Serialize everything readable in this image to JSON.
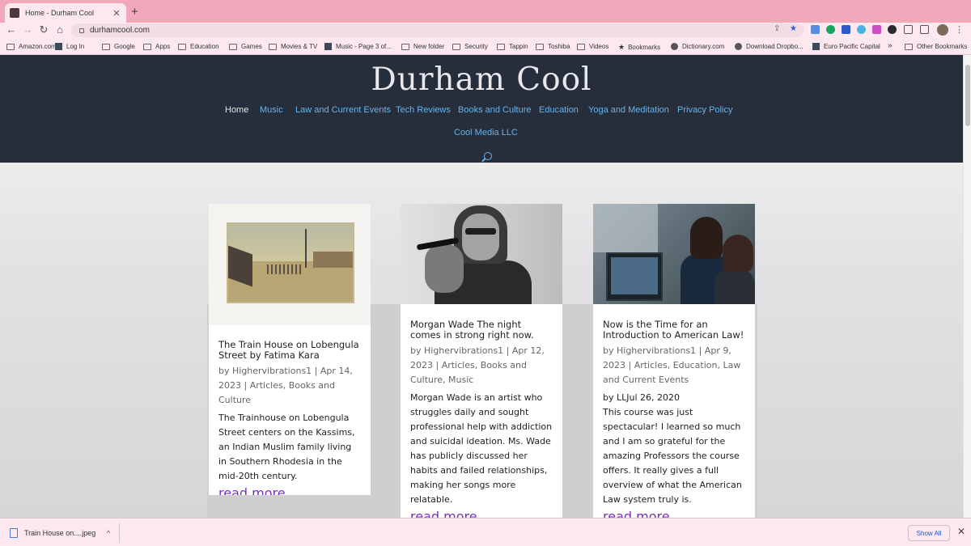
{
  "browser": {
    "tab_title": "Home - Durham Cool",
    "tab_close": "✕",
    "new_tab": "+",
    "url": "durhamcool.com",
    "bookmarks": [
      {
        "label": "Amazon.com",
        "icon": "folder"
      },
      {
        "label": "Log In",
        "icon": "square"
      },
      {
        "label": "Google",
        "icon": "folder"
      },
      {
        "label": "Apps",
        "icon": "folder"
      },
      {
        "label": "Education",
        "icon": "folder"
      },
      {
        "label": "Games",
        "icon": "folder"
      },
      {
        "label": "Movies & TV",
        "icon": "folder"
      },
      {
        "label": "Music - Page 3 of...",
        "icon": "square"
      },
      {
        "label": "New folder",
        "icon": "folder"
      },
      {
        "label": "Security",
        "icon": "folder"
      },
      {
        "label": "Tappin",
        "icon": "folder"
      },
      {
        "label": "Toshiba",
        "icon": "folder"
      },
      {
        "label": "Videos",
        "icon": "folder"
      },
      {
        "label": "Bookmarks",
        "icon": "star"
      },
      {
        "label": "Dictionary.com",
        "icon": "globe"
      },
      {
        "label": "Download Dropbo...",
        "icon": "globe"
      },
      {
        "label": "Euro Pacific Capital",
        "icon": "square"
      }
    ],
    "more_bookmarks": "»",
    "other_bookmarks": "Other Bookmarks"
  },
  "site": {
    "title": "Durham Cool",
    "menu": [
      {
        "label": "Home",
        "active": true
      },
      {
        "label": "Music"
      },
      {
        "label": "Law and Current Events"
      },
      {
        "label": "Tech Reviews"
      },
      {
        "label": "Books and Culture"
      },
      {
        "label": "Education"
      },
      {
        "label": "Yoga and Meditation"
      },
      {
        "label": "Privacy Policy"
      },
      {
        "label": "Cool Media LLC"
      }
    ],
    "accent_link_color": "#69b4ea",
    "header_bg": "#262d3b",
    "read_more_color": "#7b2fb5"
  },
  "posts": [
    {
      "title": "The Train House on Lobengula Street by Fatima Kara",
      "meta": "by Highervibrations1 | Apr 14, 2023 | Articles, Books and Culture",
      "excerpt": "The Trainhouse on Lobengula Street centers on the Kassims, an Indian Muslim family living in Southern Rhodesia in the mid-20th century.",
      "read_more": "read more"
    },
    {
      "title": "Morgan Wade The night comes in strong right now.",
      "meta": "by Highervibrations1 | Apr 12, 2023 | Articles, Books and Culture, Music",
      "excerpt": "Morgan Wade is an artist who struggles daily and sought professional help with addiction and suicidal ideation. Ms. Wade has publicly discussed her habits and failed relationships, making her songs more relatable.",
      "read_more": "read more"
    },
    {
      "title": "Now is the Time for an Introduction to American Law!",
      "meta": "by Highervibrations1 | Apr 9, 2023 | Articles, Education, Law and Current Events",
      "byline": "by LLJul 26, 2020",
      "excerpt": "This course was just spectacular! I learned so much and I am so grateful for the amazing Professors the course offers. It really gives a full overview of what the American Law system truly is.",
      "read_more": "read more"
    }
  ],
  "downloads": {
    "file_name": "Train House on....jpeg",
    "show_all": "Show All",
    "close": "✕"
  }
}
